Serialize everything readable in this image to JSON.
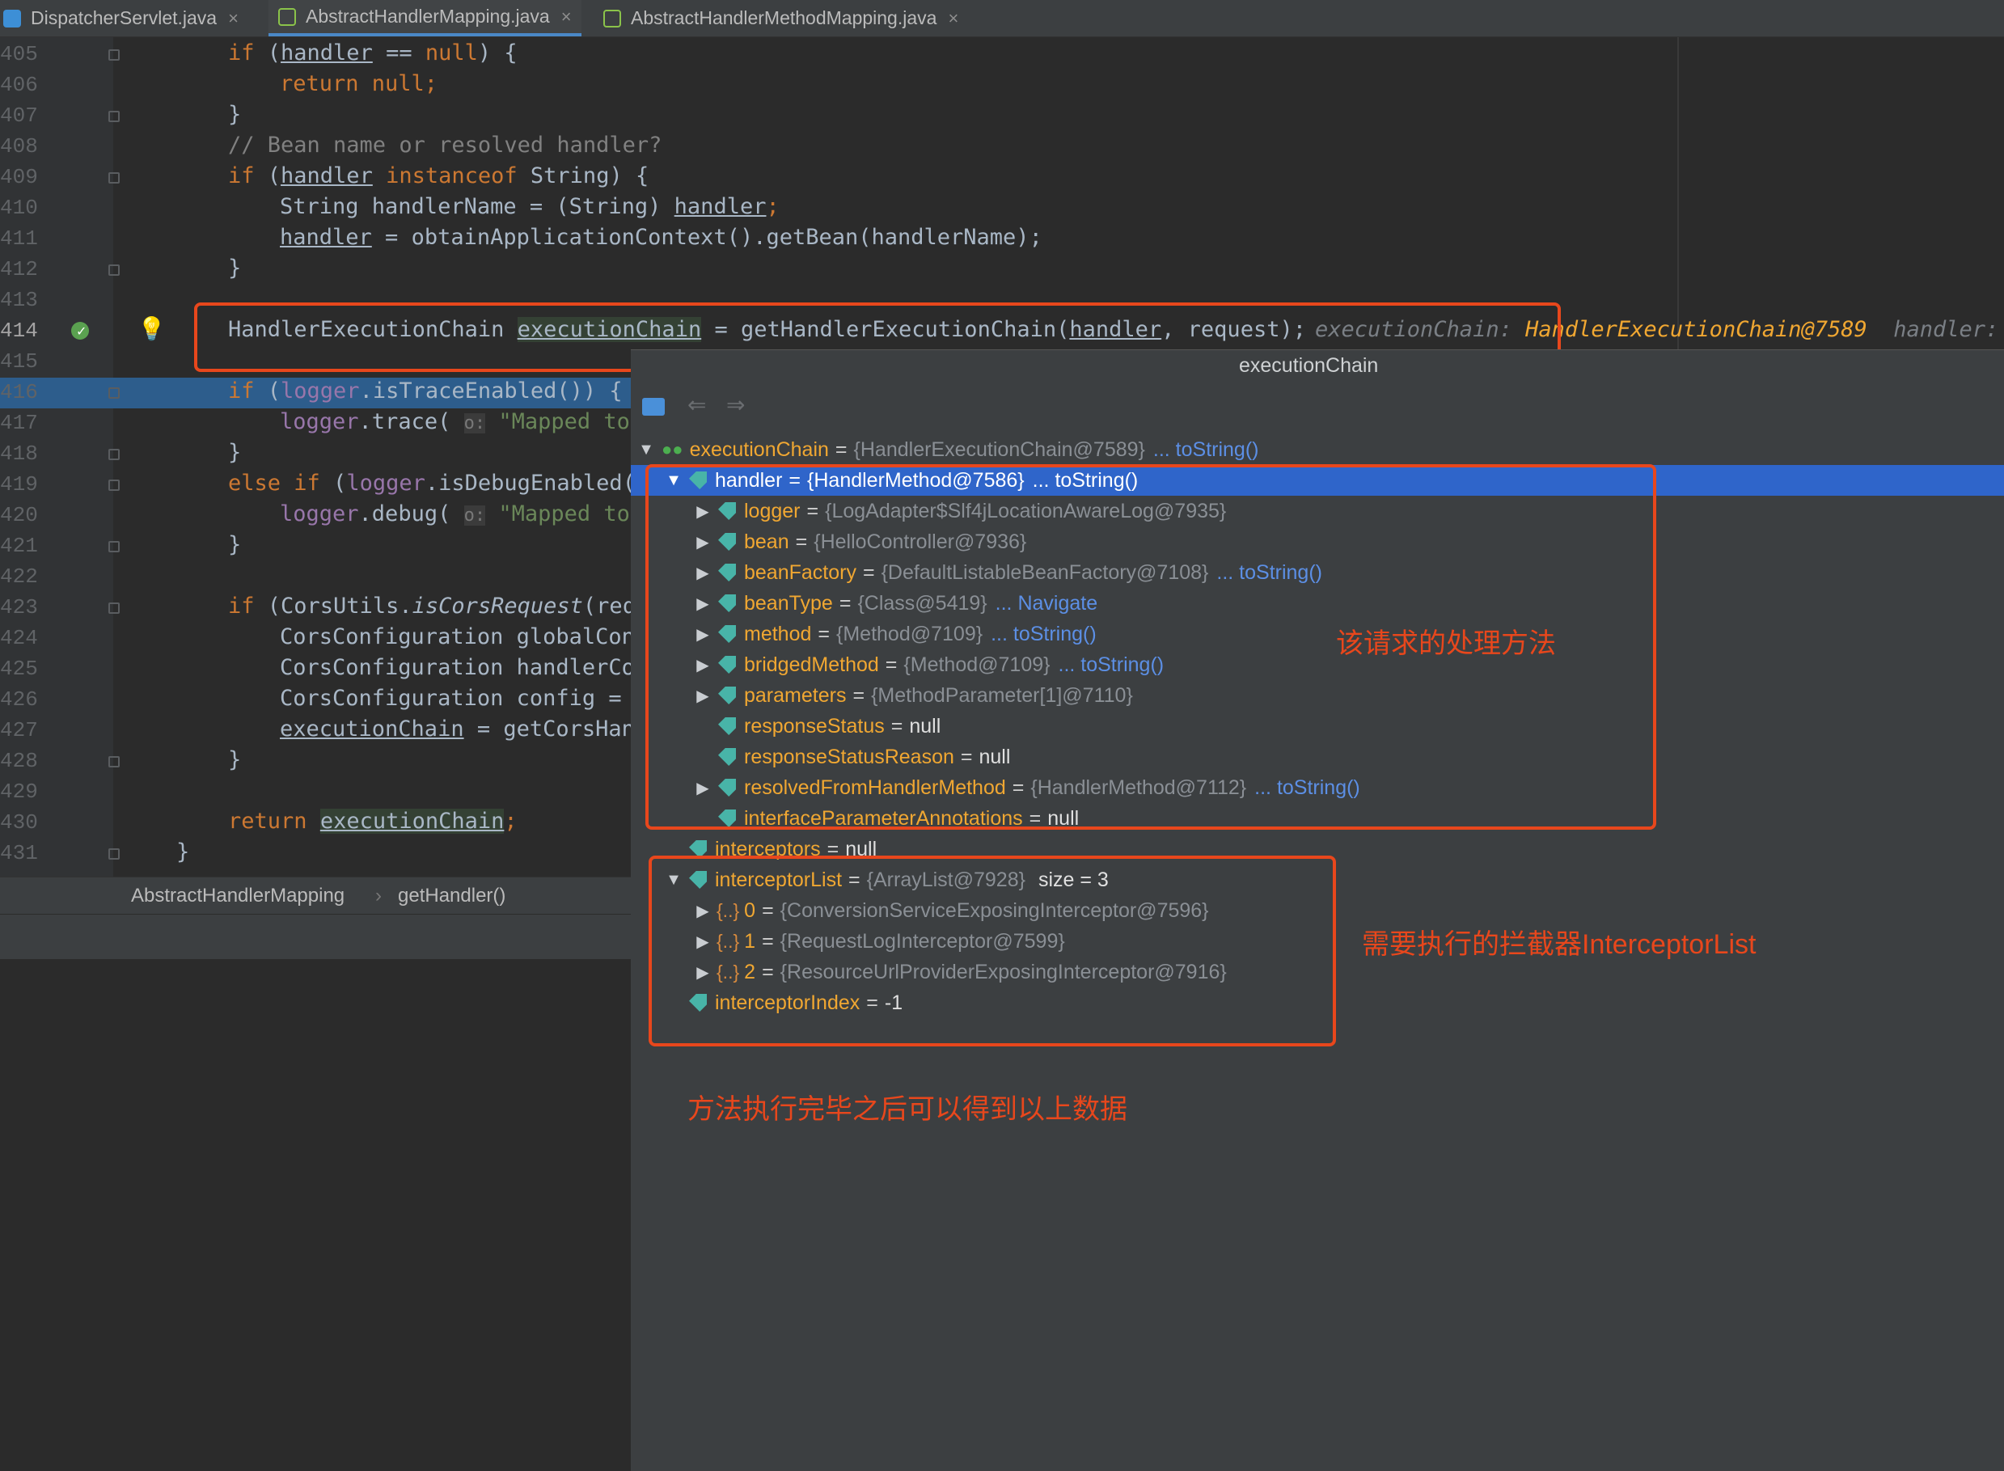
{
  "tabs": [
    {
      "label": "DispatcherServlet.java",
      "close": "×",
      "icon": "java-class-icon"
    },
    {
      "label": "AbstractHandlerMapping.java",
      "close": "×",
      "icon": "java-abstract-class-icon"
    },
    {
      "label": "AbstractHandlerMethodMapping.java",
      "close": "×",
      "icon": "java-abstract-class-icon"
    }
  ],
  "lines": [
    "405",
    "406",
    "407",
    "408",
    "409",
    "410",
    "411",
    "412",
    "413",
    "414",
    "415",
    "416",
    "417",
    "418",
    "419",
    "420",
    "421",
    "422",
    "423",
    "424",
    "425",
    "426",
    "427",
    "428",
    "429",
    "430",
    "431"
  ],
  "code": {
    "l405": [
      "if",
      " (",
      "handler",
      " == ",
      "null",
      ") {"
    ],
    "l406": [
      "return null;"
    ],
    "l407": [
      "}"
    ],
    "l408": [
      "// Bean name or resolved handler?"
    ],
    "l409": [
      "if",
      " (",
      "handler",
      " ",
      "instanceof",
      " String) {"
    ],
    "l410": [
      "String handlerName = (String) ",
      "handler",
      ";"
    ],
    "l411": [
      "handler",
      " = obtainApplicationContext().getBean(handlerName);"
    ],
    "l412": [
      "}"
    ],
    "l414": [
      "HandlerExecutionChain ",
      "executionChain",
      " = getHandlerExecutionChain(",
      "handler",
      ", request);"
    ],
    "l416": [
      "if",
      " (",
      "logger",
      ".isTraceEnabled()) {"
    ],
    "l417": [
      "logger",
      ".trace( ",
      "o:",
      " \"Mapped to"
    ],
    "l418": [
      "}"
    ],
    "l419": [
      "else if",
      " (",
      "logger",
      ".isDebugEnabled("
    ],
    "l420": [
      "logger",
      ".debug( ",
      "o:",
      " \"Mapped to"
    ],
    "l421": [
      "}"
    ],
    "l423": [
      "if",
      " (CorsUtils.",
      "isCorsRequest",
      "(req"
    ],
    "l424": [
      "CorsConfiguration globalCon"
    ],
    "l425": [
      "CorsConfiguration handlerCo"
    ],
    "l426": [
      "CorsConfiguration config ="
    ],
    "l427": [
      "executionChain",
      " = getCorsHan"
    ],
    "l428": [
      "}"
    ],
    "l430": [
      "return",
      " ",
      "executionChain",
      ";"
    ],
    "l431": [
      "}"
    ]
  },
  "inline_hint": {
    "name": "executionChain:",
    "value": "HandlerExecutionChain@7589",
    "next": "handler:"
  },
  "breadcrumb": [
    "AbstractHandlerMapping",
    "›",
    "getHandler()"
  ],
  "popup": {
    "title": "executionChain",
    "root": {
      "name": "executionChain",
      "eq": "=",
      "value": "{HandlerExecutionChain@7589}",
      "link": "... toString()"
    },
    "handler": {
      "name": "handler",
      "eq": "=",
      "value": "{HandlerMethod@7586}",
      "link": "... toString()"
    },
    "fields": [
      {
        "name": "logger",
        "value": "{LogAdapter$Slf4jLocationAwareLog@7935}",
        "link": "",
        "expand": "▶"
      },
      {
        "name": "bean",
        "value": "{HelloController@7936}",
        "link": "",
        "expand": "▶"
      },
      {
        "name": "beanFactory",
        "value": "{DefaultListableBeanFactory@7108}",
        "link": "... toString()",
        "expand": "▶"
      },
      {
        "name": "beanType",
        "value": "{Class@5419}",
        "link": "... Navigate",
        "expand": "▶"
      },
      {
        "name": "method",
        "value": "{Method@7109}",
        "link": "... toString()",
        "expand": "▶"
      },
      {
        "name": "bridgedMethod",
        "value": "{Method@7109}",
        "link": "... toString()",
        "expand": "▶"
      },
      {
        "name": "parameters",
        "value": "{MethodParameter[1]@7110}",
        "link": "",
        "expand": "▶"
      },
      {
        "name": "responseStatus",
        "value": "null",
        "link": "",
        "expand": ""
      },
      {
        "name": "responseStatusReason",
        "value": "null",
        "link": "",
        "expand": ""
      },
      {
        "name": "resolvedFromHandlerMethod",
        "value": "{HandlerMethod@7112}",
        "link": "... toString()",
        "expand": "▶"
      },
      {
        "name": "interfaceParameterAnnotations",
        "value": "null",
        "link": "",
        "expand": ""
      }
    ],
    "interceptors": {
      "name": "interceptors",
      "value": "null"
    },
    "interceptorList": {
      "name": "interceptorList",
      "value": "{ArrayList@7928}",
      "size": "size = 3"
    },
    "items": [
      {
        "idx": "0",
        "value": "{ConversionServiceExposingInterceptor@7596}"
      },
      {
        "idx": "1",
        "value": "{RequestLogInterceptor@7599}"
      },
      {
        "idx": "2",
        "value": "{ResourceUrlProviderExposingInterceptor@7916}"
      }
    ],
    "interceptorIndex": {
      "name": "interceptorIndex",
      "value": "-1"
    }
  },
  "annotations": {
    "a1": "该请求的处理方法",
    "a2": "需要执行的拦截器InterceptorList",
    "a3": "方法执行完毕之后可以得到以上数据"
  },
  "colors": {
    "accent": "#e8471c",
    "selection": "#2f65ca",
    "keyword": "#cc7832",
    "string": "#6a8759",
    "field": "#9876aa"
  }
}
